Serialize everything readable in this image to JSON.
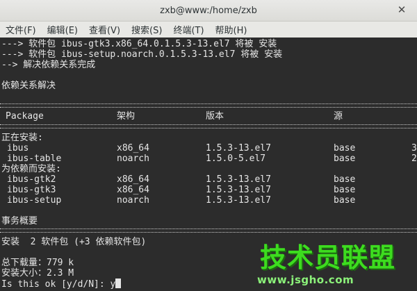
{
  "window": {
    "title": "zxb@www:/home/zxb"
  },
  "menu": [
    "文件(F)",
    "编辑(E)",
    "查看(V)",
    "搜索(S)",
    "终端(T)",
    "帮助(H)"
  ],
  "lines": {
    "l1": "---> 软件包 ibus-gtk3.x86_64.0.1.5.3-13.el7 将被 安装",
    "l2": "---> 软件包 ibus-setup.noarch.0.1.5.3-13.el7 将被 安装",
    "l3": "--> 解决依赖关系完成",
    "l4": "依赖关系解决",
    "installing": "正在安装:",
    "deps": "为依赖而安装:",
    "summary": "事务概要",
    "install": "安装  2 软件包 (+3 依赖软件包)",
    "download": "总下载量：779 k",
    "size": "安装大小：2.3 M",
    "prompt": "Is this ok [y/d/N]: y"
  },
  "headers": {
    "package": "Package",
    "arch": "架构",
    "version": "版本",
    "repo": "源"
  },
  "rows": [
    {
      "name": "ibus",
      "arch": "x86_64",
      "version": "1.5.3-13.el7",
      "repo": "base",
      "size": "3"
    },
    {
      "name": "ibus-table",
      "arch": "noarch",
      "version": "1.5.0-5.el7",
      "repo": "base",
      "size": "2"
    }
  ],
  "dep_rows": [
    {
      "name": "ibus-gtk2",
      "arch": "x86_64",
      "version": "1.5.3-13.el7",
      "repo": "base"
    },
    {
      "name": "ibus-gtk3",
      "arch": "x86_64",
      "version": "1.5.3-13.el7",
      "repo": "base"
    },
    {
      "name": "ibus-setup",
      "arch": "noarch",
      "version": "1.5.3-13.el7",
      "repo": "base"
    }
  ],
  "watermark": {
    "main": "技术员联盟",
    "url": "www.jsgho.com"
  }
}
